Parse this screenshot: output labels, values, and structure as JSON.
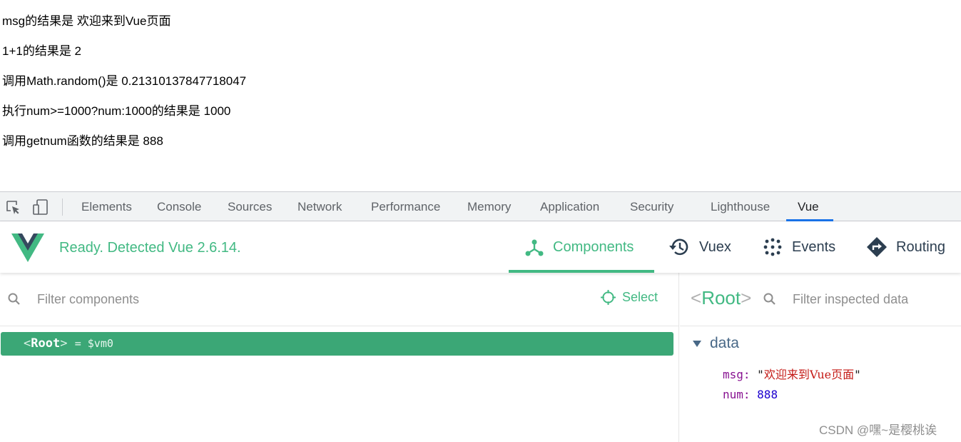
{
  "page_output": {
    "lines": [
      "msg的结果是 欢迎来到Vue页面",
      "1+1的结果是 2",
      "调用Math.random()是 0.21310137847718047",
      "执行num>=1000?num:1000的结果是 1000",
      "调用getnum函数的结果是 888"
    ]
  },
  "devtools": {
    "tabs": [
      {
        "label": "Elements"
      },
      {
        "label": "Console"
      },
      {
        "label": "Sources"
      },
      {
        "label": "Network"
      },
      {
        "label": "Performance"
      },
      {
        "label": "Memory"
      },
      {
        "label": "Application"
      },
      {
        "label": "Security"
      },
      {
        "label": "Lighthouse"
      },
      {
        "label": "Vue"
      }
    ],
    "active_tab": "Vue",
    "icons": [
      "inspect-element-icon",
      "device-toolbar-icon"
    ]
  },
  "vue_panel": {
    "status": "Ready. Detected Vue 2.6.14.",
    "nav": [
      {
        "label": "Components",
        "icon": "components-icon",
        "active": true
      },
      {
        "label": "Vuex",
        "icon": "history-icon"
      },
      {
        "label": "Events",
        "icon": "events-dots-icon"
      },
      {
        "label": "Routing",
        "icon": "routing-diamond-icon"
      }
    ],
    "accent_color": "#42b983"
  },
  "components": {
    "filter_placeholder": "Filter components",
    "select_label": "Select",
    "tree": [
      {
        "open": "<",
        "name": "Root",
        "close": ">",
        "suffix": "= $vm0",
        "selected": true
      }
    ]
  },
  "inspector": {
    "title_open": "<",
    "title_name": "Root",
    "title_close": ">",
    "filter_placeholder": "Filter inspected data",
    "section": "data",
    "props": [
      {
        "key": "msg:",
        "value": "欢迎来到Vue页面",
        "type": "string"
      },
      {
        "key": "num:",
        "value": "888",
        "type": "number"
      }
    ]
  },
  "watermark": "CSDN @嘿~是樱桃诶"
}
